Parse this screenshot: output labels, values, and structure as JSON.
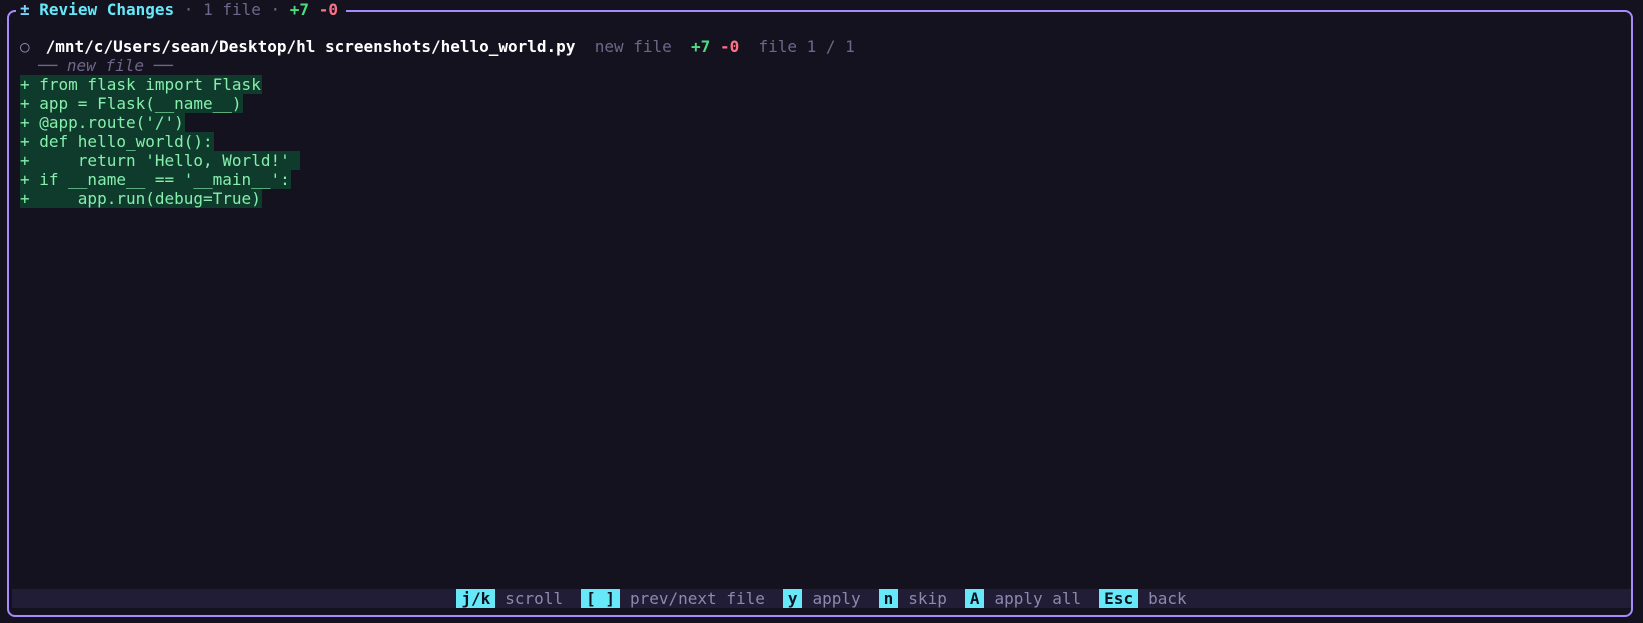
{
  "header": {
    "icon": "±",
    "title": "Review Changes",
    "separator1": "·",
    "file_count": "1 file",
    "separator2": "·",
    "additions": "+7",
    "deletions": "-0"
  },
  "file": {
    "status_icon": "○",
    "path": "/mnt/c/Users/sean/Desktop/hl screenshots/hello_world.py",
    "status": "new file",
    "additions": "+7",
    "deletions": "-0",
    "position": "file 1 / 1",
    "marker": "── new file ──"
  },
  "diff_lines": [
    "+ from flask import Flask",
    "+ app = Flask(__name__)",
    "+ @app.route('/')",
    "+ def hello_world():",
    "+     return 'Hello, World!' ",
    "+ if __name__ == '__main__':",
    "+     app.run(debug=True)"
  ],
  "footer": {
    "hints": [
      {
        "key": "j/k",
        "label": "scroll"
      },
      {
        "key": "[ ]",
        "label": "prev/next file"
      },
      {
        "key": "y",
        "label": "apply"
      },
      {
        "key": "n",
        "label": "skip"
      },
      {
        "key": "A",
        "label": "apply all"
      },
      {
        "key": "Esc",
        "label": "back"
      }
    ]
  },
  "colors": {
    "border": "#a78bfa",
    "background": "#15121f",
    "accent": "#67e8f9",
    "added": "#4ade80",
    "deleted": "#fb7185",
    "diff_bg": "#0f3b2c",
    "diff_text": "#86efac"
  }
}
